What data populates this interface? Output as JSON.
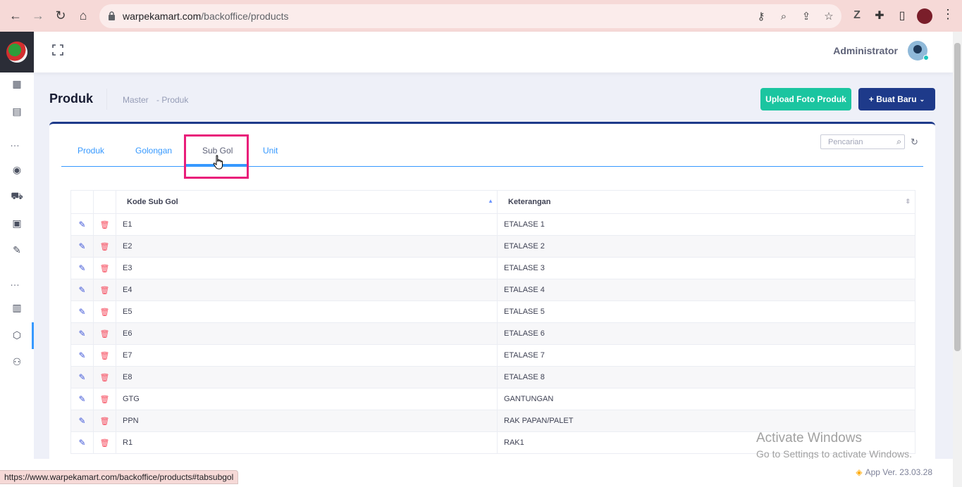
{
  "browser": {
    "url_host": "warpekamart.com",
    "url_path": "/backoffice/products",
    "status_url": "https://www.warpekamart.com/backoffice/products#tabsubgol"
  },
  "header": {
    "user_name": "Administrator"
  },
  "subheader": {
    "title": "Produk",
    "breadcrumb": [
      "Master",
      "- Produk"
    ],
    "upload_button": "Upload Foto Produk",
    "new_button": "+ Buat Baru"
  },
  "tabs": [
    {
      "label": "Produk",
      "active": false
    },
    {
      "label": "Golongan",
      "active": false
    },
    {
      "label": "Sub Gol",
      "active": true
    },
    {
      "label": "Unit",
      "active": false
    }
  ],
  "search": {
    "placeholder": "Pencarian"
  },
  "table": {
    "columns": [
      "Kode Sub Gol",
      "Keterangan"
    ],
    "rows": [
      {
        "kode": "E1",
        "ket": "ETALASE 1"
      },
      {
        "kode": "E2",
        "ket": "ETALASE 2"
      },
      {
        "kode": "E3",
        "ket": "ETALASE 3"
      },
      {
        "kode": "E4",
        "ket": "ETALASE 4"
      },
      {
        "kode": "E5",
        "ket": "ETALASE 5"
      },
      {
        "kode": "E6",
        "ket": "ETALASE 6"
      },
      {
        "kode": "E7",
        "ket": "ETALASE 7"
      },
      {
        "kode": "E8",
        "ket": "ETALASE 8"
      },
      {
        "kode": "GTG",
        "ket": "GANTUNGAN"
      },
      {
        "kode": "PPN",
        "ket": "RAK PAPAN/PALET"
      },
      {
        "kode": "R1",
        "ket": "RAK1"
      }
    ]
  },
  "watermark": {
    "line1": "Activate Windows",
    "line2": "Go to Settings to activate Windows."
  },
  "footer": {
    "app_version": "App Ver. 23.03.28"
  },
  "colors": {
    "accent": "#3699ff",
    "primary": "#1e3a8a",
    "success": "#1bc5a0",
    "highlight": "#e91e7a"
  }
}
